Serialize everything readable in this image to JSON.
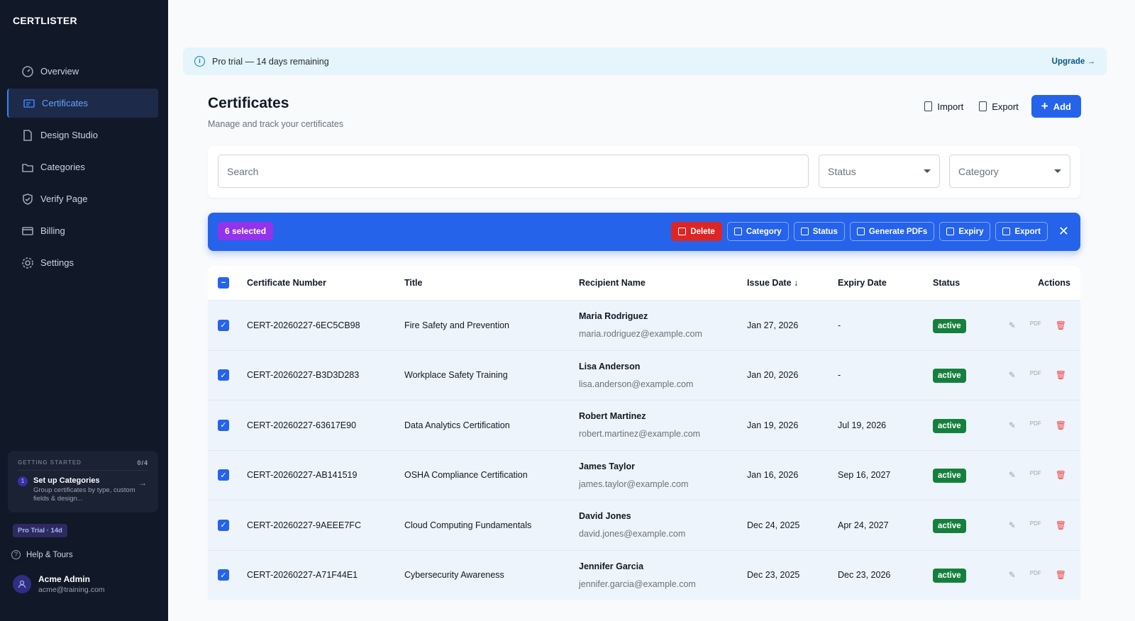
{
  "app": {
    "brand": "CERTLISTER"
  },
  "sidebar": {
    "items": [
      {
        "label": "Overview",
        "icon": "gauge-icon"
      },
      {
        "label": "Certificates",
        "icon": "certificate-icon"
      },
      {
        "label": "Design Studio",
        "icon": "pdf-icon"
      },
      {
        "label": "Categories",
        "icon": "folder-icon"
      },
      {
        "label": "Verify Page",
        "icon": "shield-check-icon"
      },
      {
        "label": "Billing",
        "icon": "credit-card-icon"
      },
      {
        "label": "Settings",
        "icon": "gear-icon"
      }
    ],
    "getting_started": {
      "title": "GETTING STARTED",
      "progress": "0/4",
      "step_num": "1",
      "step_title": "Set up Categories",
      "step_desc": "Group certificates by type, custom fields & design..."
    },
    "trial_badge": "Pro Trial · 14d",
    "help": "Help & Tours",
    "user": {
      "name": "Acme Admin",
      "email": "acme@training.com"
    }
  },
  "banner": {
    "text": "Pro trial — 14 days remaining",
    "link": "Upgrade"
  },
  "header": {
    "title": "Certificates",
    "subtitle": "Manage and track your certificates",
    "import": "Import",
    "export": "Export",
    "add": "Add"
  },
  "filters": {
    "search_placeholder": "Search",
    "status": "Status",
    "category": "Category"
  },
  "selection": {
    "count": "6 selected",
    "actions": [
      "Delete",
      "Category",
      "Status",
      "Generate PDFs",
      "Expiry",
      "Export"
    ]
  },
  "table": {
    "columns": [
      "Certificate Number",
      "Title",
      "Recipient Name",
      "Issue Date",
      "Expiry Date",
      "Status",
      "Actions"
    ],
    "rows": [
      {
        "number": "CERT-20260227-6EC5CB98",
        "title": "Fire Safety and Prevention",
        "name": "Maria Rodriguez",
        "email": "maria.rodriguez@example.com",
        "issue": "Jan 27, 2026",
        "expiry": "-",
        "status": "active"
      },
      {
        "number": "CERT-20260227-B3D3D283",
        "title": "Workplace Safety Training",
        "name": "Lisa Anderson",
        "email": "lisa.anderson@example.com",
        "issue": "Jan 20, 2026",
        "expiry": "-",
        "status": "active"
      },
      {
        "number": "CERT-20260227-63617E90",
        "title": "Data Analytics Certification",
        "name": "Robert Martinez",
        "email": "robert.martinez@example.com",
        "issue": "Jan 19, 2026",
        "expiry": "Jul 19, 2026",
        "status": "active"
      },
      {
        "number": "CERT-20260227-AB141519",
        "title": "OSHA Compliance Certification",
        "name": "James Taylor",
        "email": "james.taylor@example.com",
        "issue": "Jan 16, 2026",
        "expiry": "Sep 16, 2027",
        "status": "active"
      },
      {
        "number": "CERT-20260227-9AEEE7FC",
        "title": "Cloud Computing Fundamentals",
        "name": "David Jones",
        "email": "david.jones@example.com",
        "issue": "Dec 24, 2025",
        "expiry": "Apr 24, 2027",
        "status": "active"
      },
      {
        "number": "CERT-20260227-A71F44E1",
        "title": "Cybersecurity Awareness",
        "name": "Jennifer Garcia",
        "email": "jennifer.garcia@example.com",
        "issue": "Dec 23, 2025",
        "expiry": "Dec 23, 2026",
        "status": "active"
      }
    ]
  },
  "colors": {
    "accent": "#2563eb",
    "sidebar": "#111827",
    "active_badge": "#15803d",
    "delete": "#dc2626",
    "selected_badge": "#9333ea"
  }
}
